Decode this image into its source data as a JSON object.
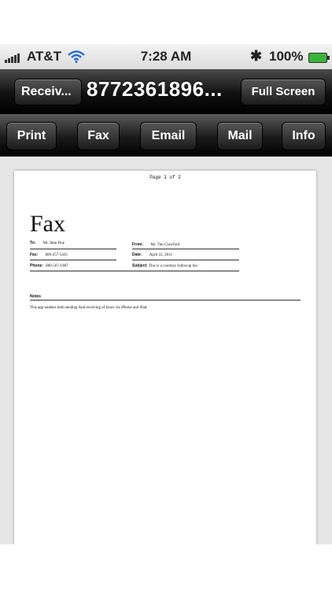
{
  "status_bar": {
    "carrier": "AT&T",
    "time": "7:28 AM",
    "battery": "100%"
  },
  "nav": {
    "back_label": "Receiv...",
    "title": "8772361896...",
    "full_screen_label": "Full Screen"
  },
  "toolbar": {
    "print_label": "Print",
    "fax_label": "Fax",
    "email_label": "Email",
    "mail_label": "Mail",
    "info_label": "Info"
  },
  "document": {
    "page_indicator": "Page 1 of 2",
    "heading": "Fax",
    "to_label": "To:",
    "to_value": "Mr. John Doe",
    "from_label": "From:",
    "from_value": "Mr. Tim Crawford",
    "fax_label": "Fax:",
    "fax_value": "800-257-5435",
    "date_label": "Date:",
    "date_value": "April 22, 2011",
    "phone_label": "Phone:",
    "phone_value": "800-567-1987",
    "subject_label": "Subject:",
    "subject_value": "This is a courtesy followup fax.",
    "notes_label": "Notes",
    "notes_text": "This app enables both sending And receiving of faxes via iPhone and iPad."
  }
}
